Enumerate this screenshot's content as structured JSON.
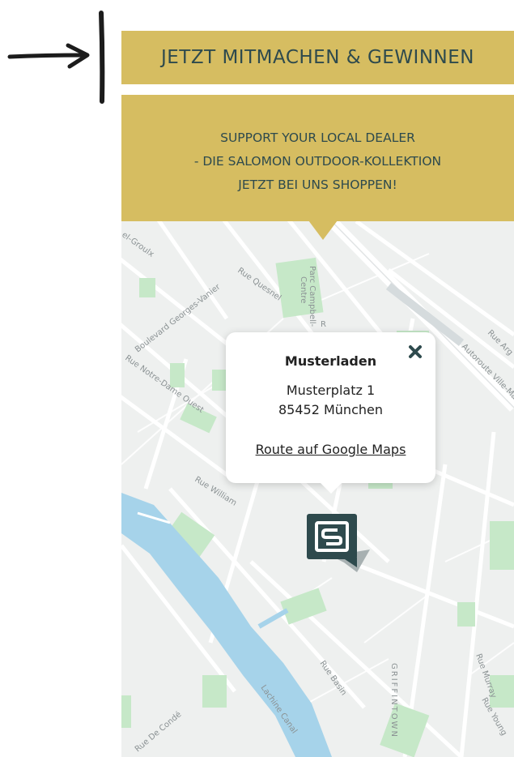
{
  "cta": {
    "label": "JETZT MITMACHEN & GEWINNEN"
  },
  "promo": {
    "line1": "SUPPORT YOUR LOCAL DEALER",
    "line2": "- DIE SALOMON OUTDOOR-KOLLEKTION",
    "line3": "JETZT BEI UNS SHOPPEN!"
  },
  "popup": {
    "store_name": "Musterladen",
    "street": "Musterplatz 1",
    "city": "85452 München",
    "route_link": "Route auf Google Maps",
    "close_icon": "close-x-icon"
  },
  "marker": {
    "letter": "S",
    "icon": "store-marker-icon"
  },
  "map": {
    "labels": {
      "groulx": "el-Groulx",
      "quesnel": "Rue Quesnel",
      "parc_campbell": "Parc Campbell-",
      "centre": "Centre",
      "georges_vanier": "Boulevard Georges-Vanier",
      "notre_dame": "Rue Notre-Dame Ouest",
      "william": "Rue William",
      "autoroute": "Autoroute Ville-Marie",
      "rue_arg": "Rue Arg",
      "basin": "Rue Basin",
      "griffintown": "GRIFFINTOWN",
      "lachine": "Lachine Canal",
      "murray": "Rue Murray",
      "young": "Rue Young",
      "conde": "Rue De Condé",
      "rue_r": "R"
    }
  },
  "colors": {
    "gold": "#d6bd61",
    "dark_teal": "#2e4a4d",
    "map_bg": "#eef0ef",
    "park": "#c6e8c8",
    "water": "#a6d3ea"
  }
}
